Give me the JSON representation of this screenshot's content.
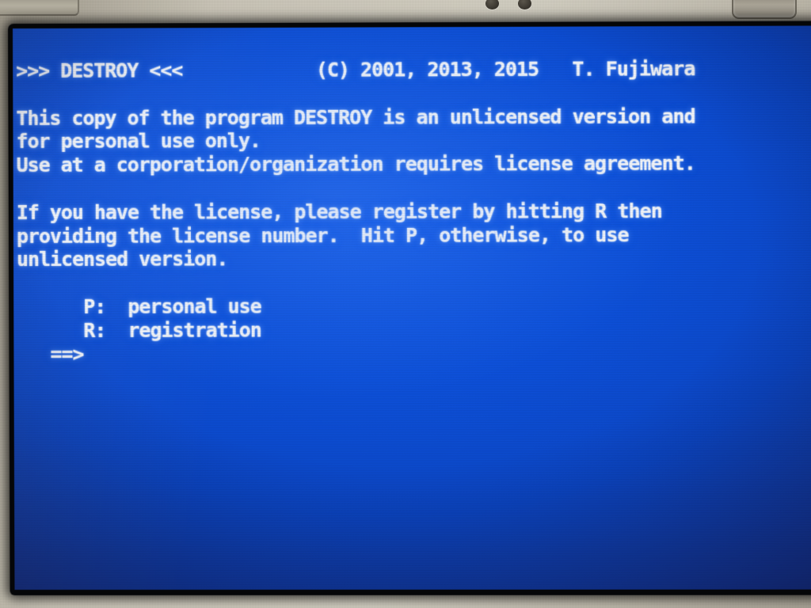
{
  "device": {
    "description": "photo of a laptop screen running a DOS-era program",
    "bezel_color": "#c9c4b6",
    "screen_bg_color": "#0c4bd0",
    "text_color": "#f2f4f8"
  },
  "program": {
    "name": "DESTROY",
    "header_left": ">>> DESTROY <<<",
    "copyright": "(C) 2001, 2013, 2015",
    "author": "T. Fujiwara"
  },
  "console": {
    "lines": [
      ">>> DESTROY <<<            (C) 2001, 2013, 2015   T. Fujiwara",
      "",
      "This copy of the program DESTROY is an unlicensed version and",
      "for personal use only.",
      "Use at a corporation/organization requires license agreement.",
      "",
      "If you have the license, please register by hitting R then",
      "providing the license number.  Hit P, otherwise, to use",
      "unlicensed version.",
      "",
      "      P:  personal use",
      "      R:  registration",
      "   ==>"
    ],
    "menu": [
      {
        "key": "P",
        "label": "personal use"
      },
      {
        "key": "R",
        "label": "registration"
      }
    ],
    "prompt": "==>",
    "input_value": ""
  }
}
